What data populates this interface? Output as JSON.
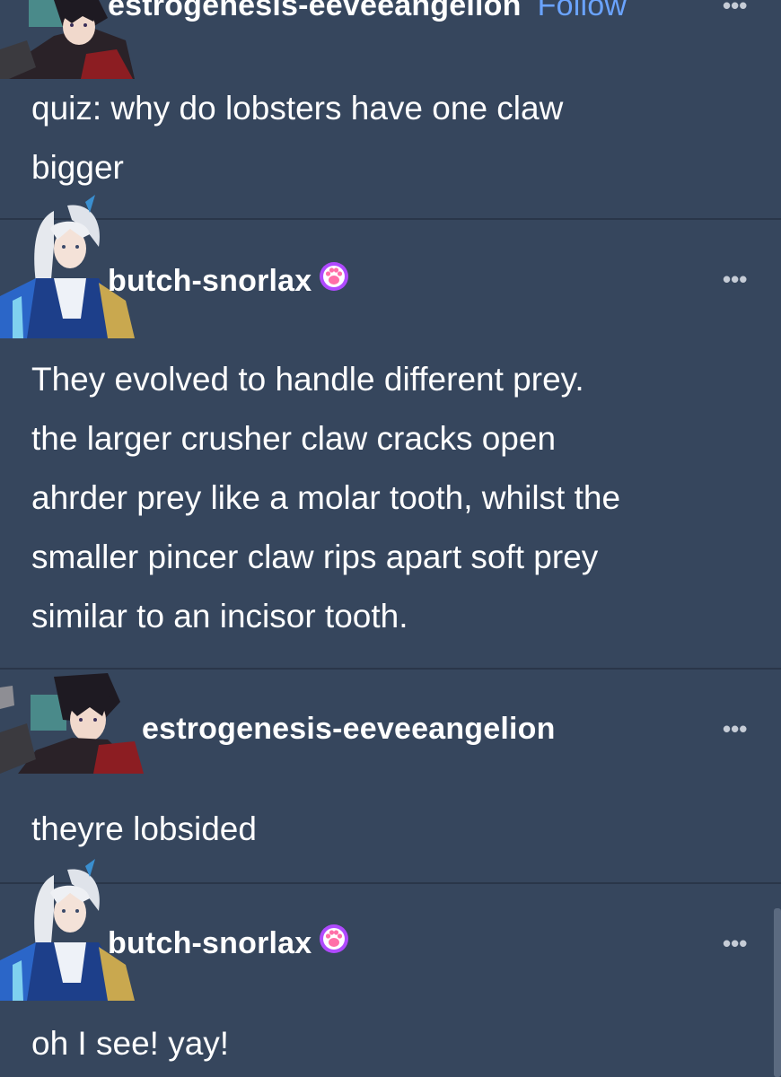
{
  "thread": {
    "posts": [
      {
        "username": "estrogenesis-eeveeangelion",
        "follow_label": "Follow",
        "avatar": "dark-haired-character-avatar",
        "more_icon": "ellipsis-icon",
        "lines": [
          "quiz: why do lobsters have one claw",
          "bigger"
        ]
      },
      {
        "username": "butch-snorlax",
        "badge": "paw-badge-icon",
        "avatar": "white-haired-character-avatar",
        "more_icon": "ellipsis-icon",
        "lines": [
          "They evolved to handle different prey.",
          "the larger crusher claw cracks open",
          "ahrder prey like a molar tooth, whilst the",
          "smaller pincer claw rips apart soft prey",
          "similar to an incisor tooth."
        ]
      },
      {
        "username": "estrogenesis-eeveeangelion",
        "avatar": "dark-haired-character-avatar",
        "more_icon": "ellipsis-icon",
        "lines": [
          "theyre lobsided"
        ]
      },
      {
        "username": "butch-snorlax",
        "badge": "paw-badge-icon",
        "avatar": "white-haired-character-avatar",
        "more_icon": "ellipsis-icon",
        "lines": [
          "oh I see! yay!"
        ]
      }
    ],
    "more_glyph": "•••"
  },
  "colors": {
    "background": "#36465d",
    "text": "#ffffff",
    "follow": "#6aa3ff",
    "badge": "#b04aff"
  }
}
